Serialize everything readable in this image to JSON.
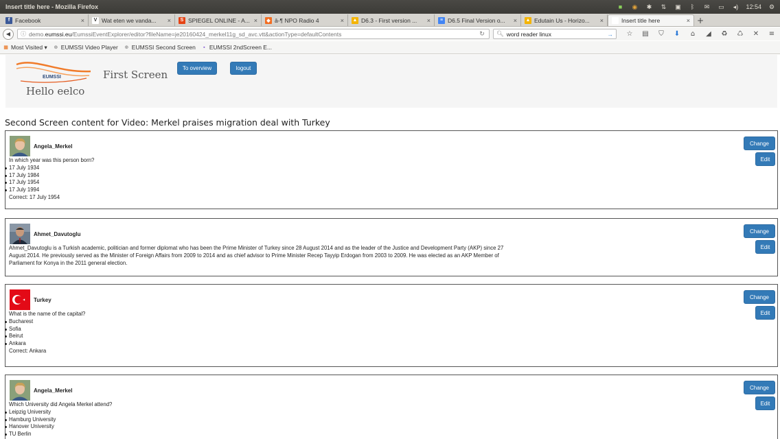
{
  "os": {
    "window_title": "Insert title here - Mozilla Firefox",
    "clock": "12:54"
  },
  "tabs": [
    {
      "label": "Facebook",
      "icon": "facebook-icon",
      "color": "#3b5998",
      "glyph": "f"
    },
    {
      "label": "Wat eten we vanda...",
      "icon": "v-icon",
      "color": "#ffffff",
      "glyph": "V"
    },
    {
      "label": "SPIEGEL ONLINE - A...",
      "icon": "spiegel-icon",
      "color": "#e64415",
      "glyph": "S"
    },
    {
      "label": "ā-¶ NPO Radio 4",
      "icon": "npo-icon",
      "color": "#f26d21",
      "glyph": "◆"
    },
    {
      "label": "D6.3 - First version ...",
      "icon": "drive-icon",
      "color": "#f4b400",
      "glyph": "▲"
    },
    {
      "label": "D6.5 Final Version o...",
      "icon": "docs-icon",
      "color": "#4285f4",
      "glyph": "≡"
    },
    {
      "label": "Edutain Us - Horizo...",
      "icon": "drive-icon",
      "color": "#f4b400",
      "glyph": "▲"
    },
    {
      "label": "Insert title here",
      "icon": "blank-icon",
      "color": "#ffffff",
      "glyph": ""
    }
  ],
  "nav": {
    "url_prefix": "demo.",
    "url_domain": "eumssi.eu",
    "url_rest": "/EumssiEventExplorer/editor?fileName=je20160424_merkel11g_sd_avc.vtt&actionType=defaultContents",
    "search_value": "word reader linux"
  },
  "bookmarks": [
    {
      "label": "Most Visited ▾",
      "icon": "most-visited-icon"
    },
    {
      "label": "EUMSSI Video Player",
      "icon": "globe-icon"
    },
    {
      "label": "EUMSSI Second Screen",
      "icon": "globe-icon"
    },
    {
      "label": "EUMSSI 2ndScreen E...",
      "icon": "purple-icon"
    }
  ],
  "header": {
    "logo_text": "EUMSSI",
    "app_title": "First Screen",
    "greeting": "Hello eelco",
    "overview_label": "To overview",
    "logout_label": "logout"
  },
  "section_title": "Second Screen content for Video: Merkel praises migration deal with Turkey",
  "buttons": {
    "change": "Change",
    "edit": "Edit"
  },
  "cards": [
    {
      "name": "Angela_Merkel",
      "avatar": "merkel-photo",
      "question": "In which year was this person born?",
      "options": [
        "17 July 1934",
        "17 July 1984",
        "17 July 1954",
        "17 July 1994"
      ],
      "correct": "Correct: 17 July 1954"
    },
    {
      "name": "Ahmet_Davutoglu",
      "avatar": "davutoglu-photo",
      "text": "Ahmet_Davutoglu is a Turkish academic, politician and former diplomat who has been the Prime Minister of Turkey since 28 August 2014 and as the leader of the Justice and Development Party (AKP) since 27 August 2014. He previously served as the Minister of Foreign Affairs from 2009 to 2014 and as chief advisor to Prime Minister Recep Tayyip Erdogan from 2003 to 2009. He was elected as an AKP Member of Parliament for Konya in the 2011 general election."
    },
    {
      "name": "Turkey",
      "avatar": "turkey-flag",
      "question": "What is the name of the capital?",
      "options": [
        "Bucharest",
        "Sofia",
        "Beirut",
        "Ankara"
      ],
      "correct": "Correct: Ankara"
    },
    {
      "name": "Angela_Merkel",
      "avatar": "merkel-photo",
      "question": "Which University did Angela Merkel attend?",
      "options": [
        "Leipzig University",
        "Hamburg University",
        "Hanover University",
        "TU Berlin"
      ]
    }
  ]
}
